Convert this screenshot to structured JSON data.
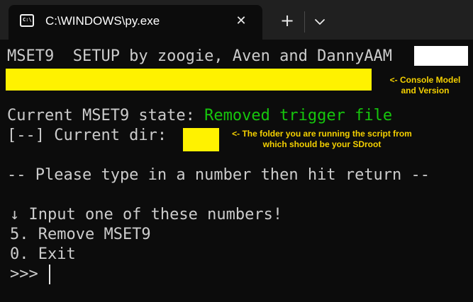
{
  "tab": {
    "icon_text": "C:\\",
    "title": "C:\\WINDOWS\\py.exe",
    "close_symbol": "✕",
    "new_tab_symbol": "+",
    "dropdown_icon": "chevron-down-icon"
  },
  "terminal": {
    "header": "MSET9  SETUP by zoogie, Aven and DannyAAM",
    "state_label": "Current MSET9 state: ",
    "state_value": "Removed trigger file",
    "dir_label": "[--] Current dir: ",
    "prompt_header": "-- Please type in a number then hit return --",
    "input_hint": "↓ Input one of these numbers!",
    "option_remove": "5. Remove MSET9",
    "option_exit": "0. Exit",
    "prompt": ">>> "
  },
  "annotations": {
    "console_model": "<- Console Model\nand Version",
    "folder_note": "<- The folder you are running the script from\nwhich should be your SDroot"
  },
  "colors": {
    "terminal_bg": "#0c0c0c",
    "tabbar_bg": "#202020",
    "text": "#cccccc",
    "state_green": "#16c60c",
    "highlight_yellow": "#fff200",
    "annotation_yellow": "#f5d100"
  }
}
